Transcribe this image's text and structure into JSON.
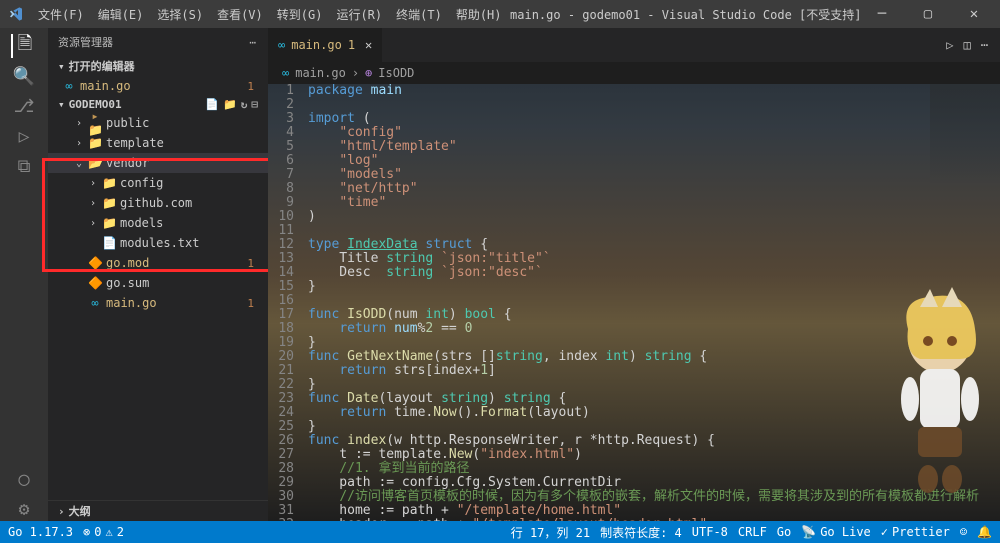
{
  "menu": [
    "文件(F)",
    "编辑(E)",
    "选择(S)",
    "查看(V)",
    "转到(G)",
    "运行(R)",
    "终端(T)",
    "帮助(H)"
  ],
  "window_title": "main.go - godemo01 - Visual Studio Code [不受支持]",
  "sidebar": {
    "header": "资源管理器",
    "open_editors": "打开的编辑器",
    "project": "GODEMO01",
    "outline": "大纲",
    "files": {
      "open_maingo": {
        "name": "main.go",
        "badge": "1"
      },
      "public": "public",
      "template": "template",
      "vendor": "vendor",
      "config": "config",
      "githubcom": "github.com",
      "models": "models",
      "modulestxt": "modules.txt",
      "gomod": {
        "name": "go.mod",
        "badge": "1"
      },
      "gosum": "go.sum",
      "maingo": {
        "name": "main.go",
        "badge": "1"
      }
    }
  },
  "tab": {
    "name": "main.go",
    "badge": "1"
  },
  "breadcrumb": {
    "file": "main.go",
    "symbol": "IsODD"
  },
  "code_lines": [
    {
      "n": 1,
      "t": [
        [
          "kw",
          "package"
        ],
        [
          "plain",
          " "
        ],
        [
          "pkg",
          "main"
        ]
      ]
    },
    {
      "n": 2,
      "t": []
    },
    {
      "n": 3,
      "t": [
        [
          "kw",
          "import"
        ],
        [
          "plain",
          " ("
        ]
      ]
    },
    {
      "n": 4,
      "t": [
        [
          "plain",
          "    "
        ],
        [
          "str",
          "\"config\""
        ]
      ]
    },
    {
      "n": 5,
      "t": [
        [
          "plain",
          "    "
        ],
        [
          "str",
          "\"html/template\""
        ]
      ]
    },
    {
      "n": 6,
      "t": [
        [
          "plain",
          "    "
        ],
        [
          "str",
          "\"log\""
        ]
      ]
    },
    {
      "n": 7,
      "t": [
        [
          "plain",
          "    "
        ],
        [
          "str",
          "\"models\""
        ]
      ]
    },
    {
      "n": 8,
      "t": [
        [
          "plain",
          "    "
        ],
        [
          "str",
          "\"net/http\""
        ]
      ]
    },
    {
      "n": 9,
      "t": [
        [
          "plain",
          "    "
        ],
        [
          "str",
          "\"time\""
        ]
      ]
    },
    {
      "n": 10,
      "t": [
        [
          "plain",
          ")"
        ]
      ]
    },
    {
      "n": 11,
      "t": []
    },
    {
      "n": 12,
      "t": [
        [
          "kw",
          "type"
        ],
        [
          "plain",
          " "
        ],
        [
          "type underline",
          "IndexData"
        ],
        [
          "plain",
          " "
        ],
        [
          "kw",
          "struct"
        ],
        [
          "plain",
          " {"
        ]
      ]
    },
    {
      "n": 13,
      "t": [
        [
          "plain",
          "    Title "
        ],
        [
          "type",
          "string"
        ],
        [
          "plain",
          " "
        ],
        [
          "str",
          "`json:\"title\"`"
        ]
      ]
    },
    {
      "n": 14,
      "t": [
        [
          "plain",
          "    Desc  "
        ],
        [
          "type",
          "string"
        ],
        [
          "plain",
          " "
        ],
        [
          "str",
          "`json:\"desc\"`"
        ]
      ]
    },
    {
      "n": 15,
      "t": [
        [
          "plain",
          "}"
        ]
      ]
    },
    {
      "n": 16,
      "t": []
    },
    {
      "n": 17,
      "t": [
        [
          "kw",
          "func"
        ],
        [
          "plain",
          " "
        ],
        [
          "func",
          "IsODD"
        ],
        [
          "plain",
          "(num "
        ],
        [
          "type",
          "int"
        ],
        [
          "plain",
          ") "
        ],
        [
          "type",
          "bool"
        ],
        [
          "plain",
          " {"
        ]
      ]
    },
    {
      "n": 18,
      "t": [
        [
          "plain",
          "    "
        ],
        [
          "kw",
          "return"
        ],
        [
          "plain",
          " "
        ],
        [
          "ident",
          "num"
        ],
        [
          "op",
          "%"
        ],
        [
          "num",
          "2"
        ],
        [
          "plain",
          " == "
        ],
        [
          "num",
          "0"
        ]
      ]
    },
    {
      "n": 19,
      "t": [
        [
          "plain",
          "}"
        ]
      ]
    },
    {
      "n": 20,
      "t": [
        [
          "kw",
          "func"
        ],
        [
          "plain",
          " "
        ],
        [
          "func",
          "GetNextName"
        ],
        [
          "plain",
          "(strs []"
        ],
        [
          "type",
          "string"
        ],
        [
          "plain",
          ", index "
        ],
        [
          "type",
          "int"
        ],
        [
          "plain",
          ") "
        ],
        [
          "type",
          "string"
        ],
        [
          "plain",
          " {"
        ]
      ]
    },
    {
      "n": 21,
      "t": [
        [
          "plain",
          "    "
        ],
        [
          "kw",
          "return"
        ],
        [
          "plain",
          " strs[index"
        ],
        [
          "op",
          "+"
        ],
        [
          "num",
          "1"
        ],
        [
          "plain",
          "]"
        ]
      ]
    },
    {
      "n": 22,
      "t": [
        [
          "plain",
          "}"
        ]
      ]
    },
    {
      "n": 23,
      "t": [
        [
          "kw",
          "func"
        ],
        [
          "plain",
          " "
        ],
        [
          "func",
          "Date"
        ],
        [
          "plain",
          "(layout "
        ],
        [
          "type",
          "string"
        ],
        [
          "plain",
          ") "
        ],
        [
          "type",
          "string"
        ],
        [
          "plain",
          " {"
        ]
      ]
    },
    {
      "n": 24,
      "t": [
        [
          "plain",
          "    "
        ],
        [
          "kw",
          "return"
        ],
        [
          "plain",
          " time."
        ],
        [
          "func",
          "Now"
        ],
        [
          "plain",
          "()."
        ],
        [
          "func",
          "Format"
        ],
        [
          "plain",
          "(layout)"
        ]
      ]
    },
    {
      "n": 25,
      "t": [
        [
          "plain",
          "}"
        ]
      ]
    },
    {
      "n": 26,
      "t": [
        [
          "kw",
          "func"
        ],
        [
          "plain",
          " "
        ],
        [
          "func",
          "index"
        ],
        [
          "plain",
          "(w http.ResponseWriter, r *http.Request) {"
        ]
      ]
    },
    {
      "n": 27,
      "t": [
        [
          "plain",
          "    t := template."
        ],
        [
          "func",
          "New"
        ],
        [
          "plain",
          "("
        ],
        [
          "str",
          "\"index.html\""
        ],
        [
          "plain",
          ")"
        ]
      ]
    },
    {
      "n": 28,
      "t": [
        [
          "plain",
          "    "
        ],
        [
          "comment",
          "//1. 拿到当前的路径"
        ]
      ]
    },
    {
      "n": 29,
      "t": [
        [
          "plain",
          "    path := config.Cfg.System.CurrentDir"
        ]
      ]
    },
    {
      "n": 30,
      "t": [
        [
          "plain",
          "    "
        ],
        [
          "comment",
          "//访问博客首页模板的时候，因为有多个模板的嵌套，解析文件的时候，需要将其涉及到的所有模板都进行解析"
        ]
      ]
    },
    {
      "n": 31,
      "t": [
        [
          "plain",
          "    home := path + "
        ],
        [
          "str",
          "\"/template/home.html\""
        ]
      ]
    },
    {
      "n": 32,
      "t": [
        [
          "plain",
          "    header := path + "
        ],
        [
          "str",
          "\"/template/layout/header.html\""
        ]
      ]
    }
  ],
  "status": {
    "go_version": "Go 1.17.3",
    "errors": "0",
    "warnings": "2",
    "cursor": "行 17，列 21",
    "tab": "制表符长度: 4",
    "encoding": "UTF-8",
    "eol": "CRLF",
    "lang": "Go",
    "golive": "Go Live",
    "prettier": "Prettier"
  }
}
